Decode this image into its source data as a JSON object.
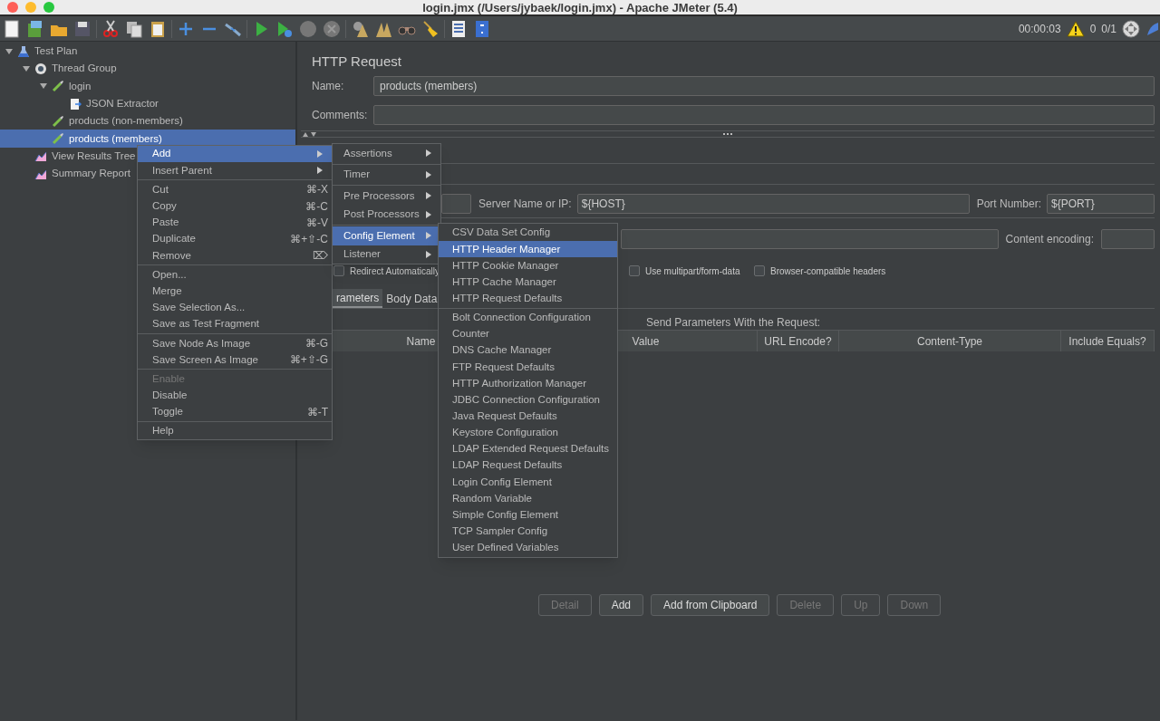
{
  "window": {
    "title": "login.jmx (/Users/jybaek/login.jmx) - Apache JMeter (5.4)"
  },
  "toolbar": {
    "elapsed": "00:00:03",
    "warnings": "0",
    "threads": "0/1"
  },
  "tree": [
    {
      "label": "Test Plan",
      "kind": "plan",
      "expanded": true,
      "selected": false,
      "children": [
        {
          "label": "Thread Group",
          "kind": "thread_group",
          "expanded": true,
          "selected": false,
          "children": [
            {
              "label": "login",
              "kind": "sampler",
              "expanded": true,
              "selected": false,
              "children": [
                {
                  "label": "JSON Extractor",
                  "kind": "extractor",
                  "selected": false
                }
              ]
            },
            {
              "label": "products (non-members)",
              "kind": "sampler",
              "selected": false
            },
            {
              "label": "products (members)",
              "kind": "sampler",
              "selected": true
            }
          ]
        },
        {
          "label": "View Results Tree",
          "kind": "listener",
          "selected": false
        },
        {
          "label": "Summary Report",
          "kind": "listener",
          "selected": false
        }
      ]
    }
  ],
  "context_menu": [
    [
      {
        "label": "Add",
        "submenu": true,
        "selected": true,
        "disabled": false
      },
      {
        "label": "Insert Parent",
        "submenu": true,
        "selected": false,
        "disabled": false
      }
    ],
    [
      {
        "label": "Cut",
        "shortcut": "⌘-X",
        "selected": false,
        "disabled": false
      },
      {
        "label": "Copy",
        "shortcut": "⌘-C",
        "selected": false,
        "disabled": false
      },
      {
        "label": "Paste",
        "shortcut": "⌘-V",
        "selected": false,
        "disabled": false
      },
      {
        "label": "Duplicate",
        "shortcut": "⌘+⇧-C",
        "selected": false,
        "disabled": false
      },
      {
        "label": "Remove",
        "shortcut": "⌦",
        "selected": false,
        "disabled": false
      }
    ],
    [
      {
        "label": "Open...",
        "selected": false,
        "disabled": false
      },
      {
        "label": "Merge",
        "selected": false,
        "disabled": false
      },
      {
        "label": "Save Selection As...",
        "selected": false,
        "disabled": false
      },
      {
        "label": "Save as Test Fragment",
        "selected": false,
        "disabled": false
      }
    ],
    [
      {
        "label": "Save Node As Image",
        "shortcut": "⌘-G",
        "selected": false,
        "disabled": false
      },
      {
        "label": "Save Screen As Image",
        "shortcut": "⌘+⇧-G",
        "selected": false,
        "disabled": false
      }
    ],
    [
      {
        "label": "Enable",
        "selected": false,
        "disabled": true
      },
      {
        "label": "Disable",
        "selected": false,
        "disabled": false
      },
      {
        "label": "Toggle",
        "shortcut": "⌘-T",
        "selected": false,
        "disabled": false
      }
    ],
    [
      {
        "label": "Help",
        "selected": false,
        "disabled": false
      }
    ]
  ],
  "add_submenu": [
    [
      {
        "label": "Assertions",
        "submenu": true,
        "selected": false
      }
    ],
    [
      {
        "label": "Timer",
        "submenu": true,
        "selected": false
      }
    ],
    [
      {
        "label": "Pre Processors",
        "submenu": true,
        "selected": false
      },
      {
        "label": "Post Processors",
        "submenu": true,
        "selected": false
      }
    ],
    [
      {
        "label": "Config Element",
        "submenu": true,
        "selected": true
      },
      {
        "label": "Listener",
        "submenu": true,
        "selected": false
      }
    ]
  ],
  "config_submenu": [
    [
      {
        "label": "CSV Data Set Config",
        "selected": false
      },
      {
        "label": "HTTP Header Manager",
        "selected": true
      },
      {
        "label": "HTTP Cookie Manager",
        "selected": false
      },
      {
        "label": "HTTP Cache Manager",
        "selected": false
      },
      {
        "label": "HTTP Request Defaults",
        "selected": false
      }
    ],
    [
      {
        "label": "Bolt Connection Configuration",
        "selected": false
      },
      {
        "label": "Counter",
        "selected": false
      },
      {
        "label": "DNS Cache Manager",
        "selected": false
      },
      {
        "label": "FTP Request Defaults",
        "selected": false
      },
      {
        "label": "HTTP Authorization Manager",
        "selected": false
      },
      {
        "label": "JDBC Connection Configuration",
        "selected": false
      },
      {
        "label": "Java Request Defaults",
        "selected": false
      },
      {
        "label": "Keystore Configuration",
        "selected": false
      },
      {
        "label": "LDAP Extended Request Defaults",
        "selected": false
      },
      {
        "label": "LDAP Request Defaults",
        "selected": false
      },
      {
        "label": "Login Config Element",
        "selected": false
      },
      {
        "label": "Random Variable",
        "selected": false
      },
      {
        "label": "Simple Config Element",
        "selected": false
      },
      {
        "label": "TCP Sampler Config",
        "selected": false
      },
      {
        "label": "User Defined Variables",
        "selected": false
      }
    ]
  ],
  "editor": {
    "title": "HTTP Request",
    "name_label": "Name:",
    "name_value": "products (members)",
    "comments_label": "Comments:",
    "server_label": "Server Name or IP:",
    "server_value": "${HOST}",
    "port_label": "Port Number:",
    "port_value": "${PORT}",
    "encoding_label": "Content encoding:",
    "checkboxes": [
      {
        "label": "Redirect Automatically",
        "checked": false
      },
      {
        "label": "Use multipart/form-data",
        "checked": false
      },
      {
        "label": "Browser-compatible headers",
        "checked": false
      }
    ],
    "tabs": [
      {
        "label": "rameters",
        "selected": true
      },
      {
        "label": "Body Data",
        "selected": false
      }
    ],
    "table": {
      "caption": "Send Parameters With the Request:",
      "columns": [
        "Name",
        "Value",
        "URL Encode?",
        "Content-Type",
        "Include Equals?"
      ]
    },
    "buttons": [
      {
        "label": "Detail",
        "disabled": true
      },
      {
        "label": "Add",
        "disabled": false
      },
      {
        "label": "Add from Clipboard",
        "disabled": false
      },
      {
        "label": "Delete",
        "disabled": true
      },
      {
        "label": "Up",
        "disabled": true
      },
      {
        "label": "Down",
        "disabled": true
      }
    ]
  }
}
